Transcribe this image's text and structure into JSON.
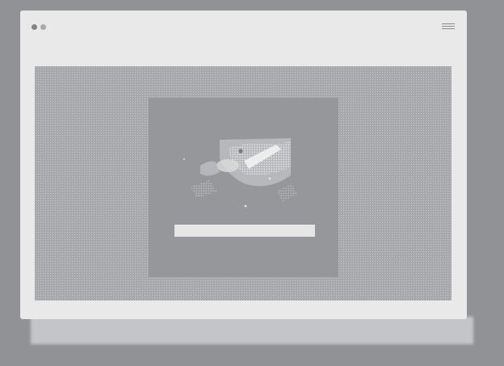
{
  "window": {
    "controls": [
      "window-dot-icon",
      "window-dot-icon"
    ],
    "menu_icon": "hamburger-menu-icon"
  },
  "main": {
    "image": "abstract-photo-image",
    "bar_label": ""
  },
  "colors": {
    "background": "#909296",
    "window": "#e9e9e9",
    "stage": "#a7a8ab",
    "card": "#95979b",
    "bar": "#e6e6e6"
  }
}
